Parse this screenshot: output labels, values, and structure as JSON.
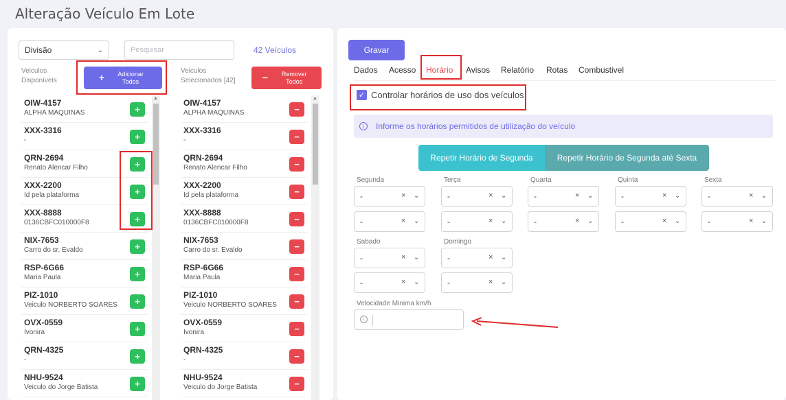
{
  "page": {
    "title": "Alteração Veículo Em Lote"
  },
  "left": {
    "division_select": "Divisão",
    "search_placeholder": "Pesquisar",
    "vehicle_count": "42 Veículos",
    "available_label": "Veiculos\nDisponíveis",
    "selected_label": "Veiculos\nSelecionados [42]",
    "add_all": "Adicionar\nTodos",
    "remove_all": "Remover\nTodos",
    "add_symbol": "+",
    "remove_symbol": "−",
    "available": [
      {
        "plate": "OIW-4157",
        "desc": "ALPHA MAQUINAS"
      },
      {
        "plate": "XXX-3316",
        "desc": "-"
      },
      {
        "plate": "QRN-2694",
        "desc": "Renato Alencar Filho"
      },
      {
        "plate": "XXX-2200",
        "desc": "Id pela plataforma"
      },
      {
        "plate": "XXX-8888",
        "desc": "0136CBFC010000F8"
      },
      {
        "plate": "NIX-7653",
        "desc": "Carro do sr. Evaldo"
      },
      {
        "plate": "RSP-6G66",
        "desc": "Maria Paula"
      },
      {
        "plate": "PIZ-1010",
        "desc": "Veiculo NORBERTO SOARES"
      },
      {
        "plate": "OVX-0559",
        "desc": "Ivonira"
      },
      {
        "plate": "QRN-4325",
        "desc": "-"
      },
      {
        "plate": "NHU-9524",
        "desc": "Veiculo do Jorge Batista"
      }
    ],
    "selected": [
      {
        "plate": "OIW-4157",
        "desc": "ALPHA MAQUINAS"
      },
      {
        "plate": "XXX-3316",
        "desc": "-"
      },
      {
        "plate": "QRN-2694",
        "desc": "Renato Alencar Filho"
      },
      {
        "plate": "XXX-2200",
        "desc": "Id pela plataforma"
      },
      {
        "plate": "XXX-8888",
        "desc": "0136CBFC010000F8"
      },
      {
        "plate": "NIX-7653",
        "desc": "Carro do sr. Evaldo"
      },
      {
        "plate": "RSP-6G66",
        "desc": "Maria Paula"
      },
      {
        "plate": "PIZ-1010",
        "desc": "Veiculo NORBERTO SOARES"
      },
      {
        "plate": "OVX-0559",
        "desc": "Ivonira"
      },
      {
        "plate": "QRN-4325",
        "desc": "-"
      },
      {
        "plate": "NHU-9524",
        "desc": "Veiculo do Jorge Batista"
      }
    ]
  },
  "right": {
    "save": "Gravar",
    "tabs": [
      "Dados",
      "Acesso",
      "Horário",
      "Avisos",
      "Relatório",
      "Rotas",
      "Combustivel"
    ],
    "active_tab": "Horário",
    "control_checkbox": "Controlar horários de uso dos veículos",
    "info_icon": "i",
    "info_text": "Informe os horários permitidos de utilização do veículo",
    "repeat_monday": "Repetir Horário de Segunda",
    "repeat_mon_fri": "Repetir Horário de Segunda até Sexta",
    "days": [
      "Segunda",
      "Terça",
      "Quarta",
      "Quinta",
      "Sexta",
      "Sabado",
      "Domingo"
    ],
    "time_value": "-",
    "clear_symbol": "×",
    "min_speed_label": "Velocidade Minima km/h",
    "min_speed_value": ""
  },
  "colors": {
    "primary": "#6e6be8",
    "danger": "#e8474f",
    "success": "#2fbf5e",
    "teal": "#3cc2cf",
    "teal_dark": "#5aa9ad",
    "highlight": "#e02b2b"
  },
  "icons": [
    "chevron-down-icon",
    "plus-icon",
    "minus-icon",
    "check-icon",
    "info-icon",
    "close-icon",
    "arrow-icon"
  ]
}
